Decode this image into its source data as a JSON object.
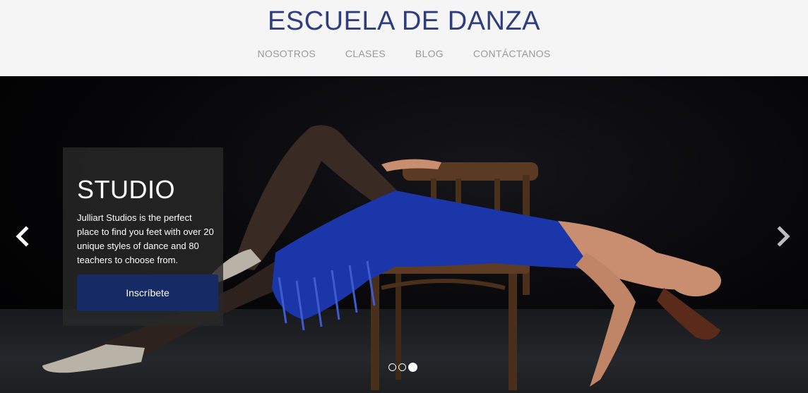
{
  "header": {
    "title": "ESCUELA DE DANZA",
    "nav": [
      {
        "label": "NOSOTROS"
      },
      {
        "label": "CLASES"
      },
      {
        "label": "BLOG"
      },
      {
        "label": "CONTÁCTANOS"
      }
    ]
  },
  "carousel": {
    "slide": {
      "title": "STUDIO",
      "text": "Julliart Studios is the perfect place to find you feet with over 20 unique styles of dance and 80 teachers to choose from.",
      "button_label": "Inscríbete"
    },
    "prev_icon": "chevron-left-icon",
    "next_icon": "chevron-right-icon",
    "indicator_count": 3,
    "active_indicator": 3
  },
  "colors": {
    "title": "#2e3d7f",
    "header_bg": "#f5f5f5",
    "nav_text": "#9a9a9a",
    "button_bg": "#162a66",
    "dress": "#1b36a8"
  }
}
